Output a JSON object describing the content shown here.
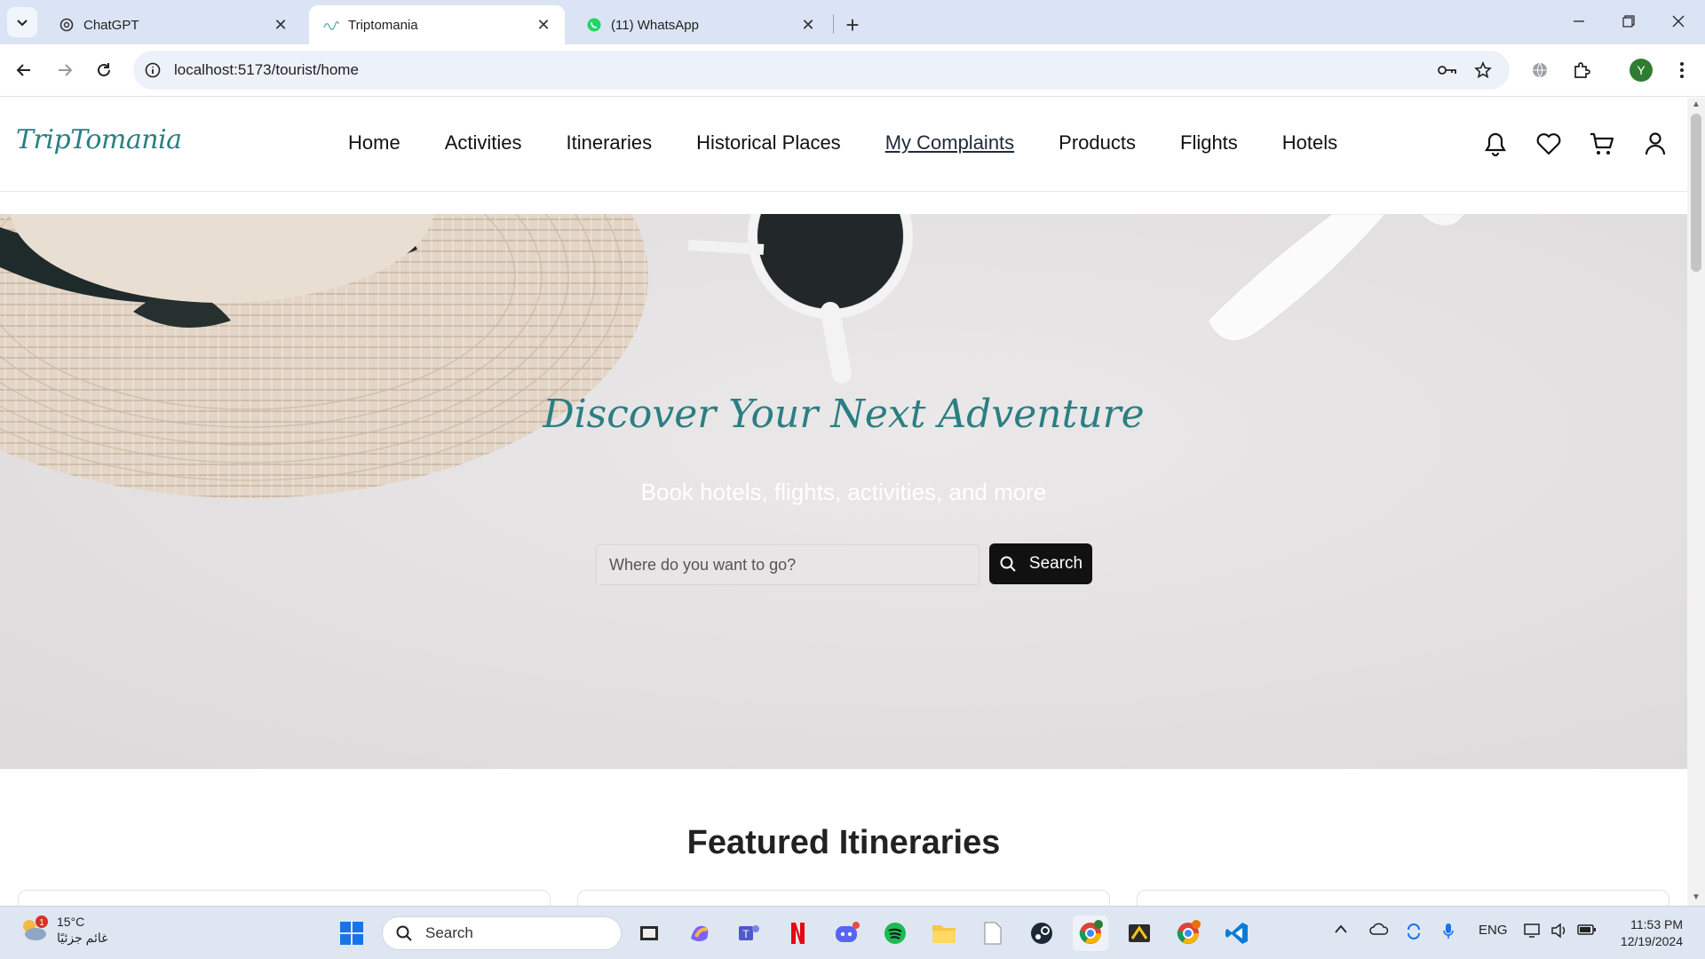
{
  "browser": {
    "tabs": [
      {
        "title": "ChatGPT",
        "icon": "chatgpt-icon",
        "active": false
      },
      {
        "title": "Triptomania",
        "icon": "triptomania-icon",
        "active": true
      },
      {
        "title": "(11) WhatsApp",
        "icon": "whatsapp-icon",
        "active": false
      }
    ],
    "url": "localhost:5173/tourist/home",
    "profile_initial": "Y"
  },
  "site": {
    "logo": "TripTomania",
    "nav": [
      "Home",
      "Activities",
      "Itineraries",
      "Historical Places",
      "My Complaints",
      "Products",
      "Flights",
      "Hotels"
    ],
    "current_nav": "My Complaints"
  },
  "hero": {
    "title": "Discover Your Next Adventure",
    "subtitle": "Book hotels, flights, activities, and more",
    "search_placeholder": "Where do you want to go?",
    "search_button": "Search"
  },
  "featured": {
    "title": "Featured Itineraries"
  },
  "taskbar": {
    "weather_temp": "15°C",
    "weather_desc": "غائم جزئيًا",
    "weather_badge": "1",
    "search_label": "Search",
    "language": "ENG",
    "time": "11:53 PM",
    "date": "12/19/2024"
  },
  "colors": {
    "brand": "#2a7f83",
    "tabbar": "#dbe4f5",
    "taskbar": "#dee6f2"
  }
}
